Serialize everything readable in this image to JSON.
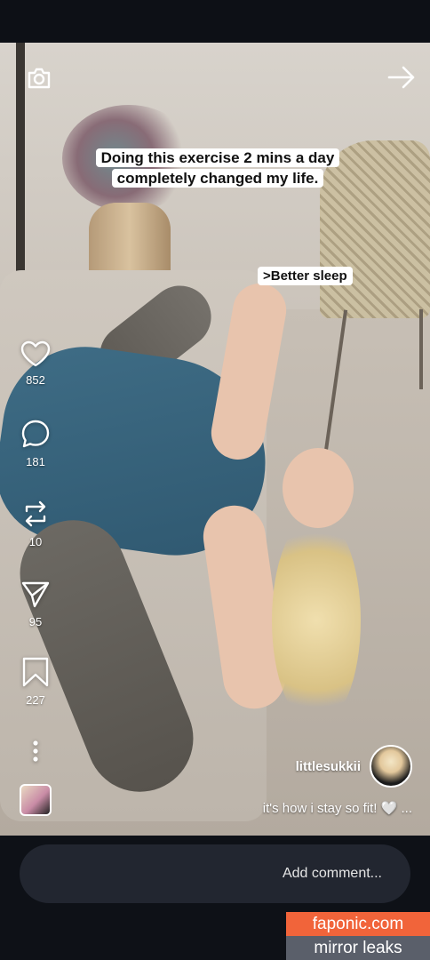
{
  "reel": {
    "overlay_caption_lines": [
      "Doing this exercise 2 mins a day",
      "completely changed my life."
    ],
    "sticker_text": ">Better sleep"
  },
  "top_icons": {
    "camera": "camera-icon",
    "forward": "arrow-right-icon"
  },
  "actions": [
    {
      "icon": "heart-icon",
      "count": "852"
    },
    {
      "icon": "comment-icon",
      "count": "181"
    },
    {
      "icon": "repost-icon",
      "count": "10"
    },
    {
      "icon": "share-icon",
      "count": "95"
    },
    {
      "icon": "bookmark-icon",
      "count": "227"
    }
  ],
  "post": {
    "username": "littlesukkii",
    "caption": "it's how i stay so fit! 🤍 ..."
  },
  "comment": {
    "placeholder": "Add comment..."
  },
  "watermark": {
    "line1": "faponic.com",
    "line2": "mirror leaks"
  },
  "colors": {
    "background": "#0b0d12",
    "comment_box": "#222630",
    "watermark_orange": "#f1643a",
    "watermark_gray": "#5a5f6a"
  }
}
